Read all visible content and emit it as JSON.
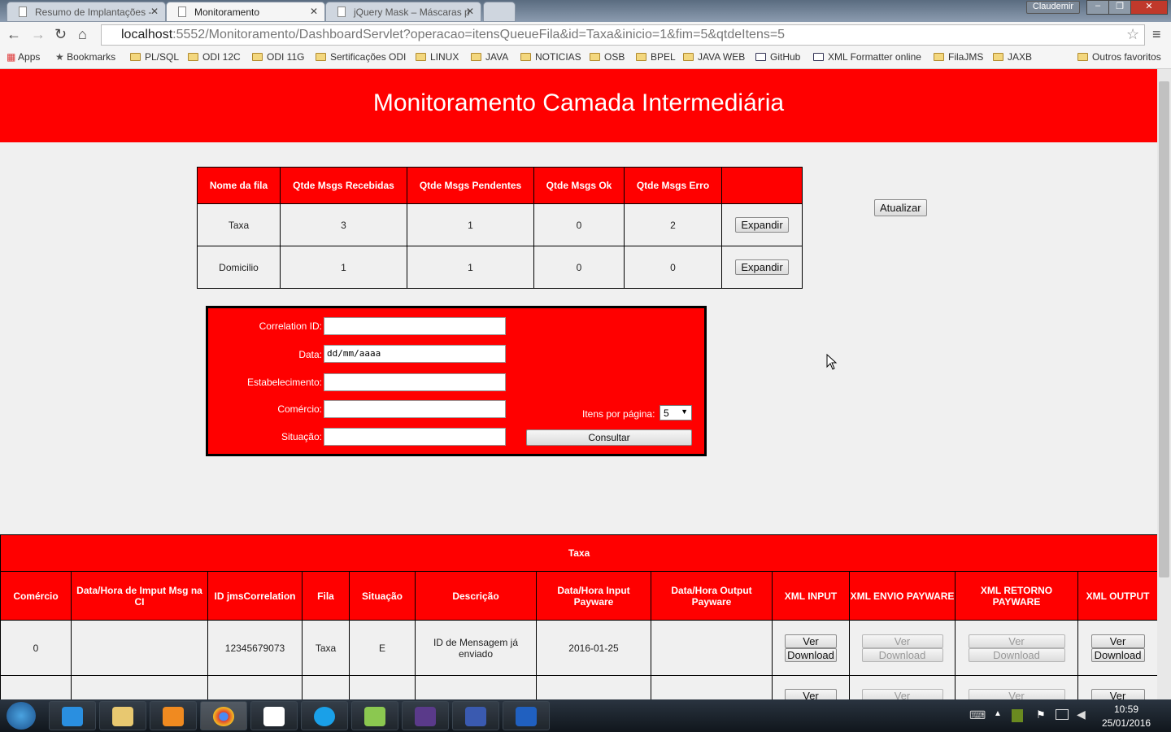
{
  "browser": {
    "tabs": [
      {
        "label": "Resumo de Implantações -"
      },
      {
        "label": "Monitoramento"
      },
      {
        "label": "jQuery Mask – Máscaras p"
      }
    ],
    "window_user": "Claudemir",
    "url_host": "localhost",
    "url_rest": ":5552/Monitoramento/DashboardServlet?operacao=itensQueueFila&id=Taxa&inicio=1&fim=5&qtdeItens=5",
    "bookmarks": [
      "Apps",
      "Bookmarks",
      "PL/SQL",
      "ODI 12C",
      "ODI 11G",
      "Sertificações ODI",
      "LINUX",
      "JAVA",
      "NOTICIAS",
      "OSB",
      "BPEL",
      "JAVA WEB",
      "GitHub",
      "XML Formatter online",
      "FilaJMS",
      "JAXB"
    ],
    "other_bookmarks": "Outros favoritos"
  },
  "page": {
    "title": "Monitoramento Camada Intermediária",
    "queues": {
      "headers": [
        "Nome da fila",
        "Qtde Msgs Recebidas",
        "Qtde Msgs Pendentes",
        "Qtde Msgs Ok",
        "Qtde Msgs Erro",
        ""
      ],
      "rows": [
        [
          "Taxa",
          "3",
          "1",
          "0",
          "2"
        ],
        [
          "Domicilio",
          "1",
          "1",
          "0",
          "0"
        ]
      ],
      "expand_label": "Expandir"
    },
    "refresh_label": "Atualizar",
    "form": {
      "correlation_label": "Correlation ID:",
      "date_label": "Data:",
      "date_placeholder": "dd/mm/aaaa",
      "establishment_label": "Estabelecimento:",
      "commerce_label": "Comércio:",
      "status_label": "Situação:",
      "per_page_label": "Itens por página:",
      "per_page_value": "5",
      "submit_label": "Consultar"
    },
    "detail": {
      "title": "Taxa",
      "headers": [
        "Comércio",
        "Data/Hora de Imput Msg na CI",
        "ID jmsCorrelation",
        "Fila",
        "Situação",
        "Descrição",
        "Data/Hora Input Payware",
        "Data/Hora Output Payware",
        "XML INPUT",
        "XML ENVIO PAYWARE",
        "XML RETORNO PAYWARE",
        "XML OUTPUT"
      ],
      "rows": [
        [
          "0",
          "",
          "12345679073",
          "Taxa",
          "E",
          "ID de Mensagem já enviado",
          "2016-01-25",
          ""
        ]
      ],
      "view_label": "Ver",
      "download_label": "Download"
    }
  },
  "taskbar": {
    "time": "10:59",
    "date": "25/01/2016"
  }
}
